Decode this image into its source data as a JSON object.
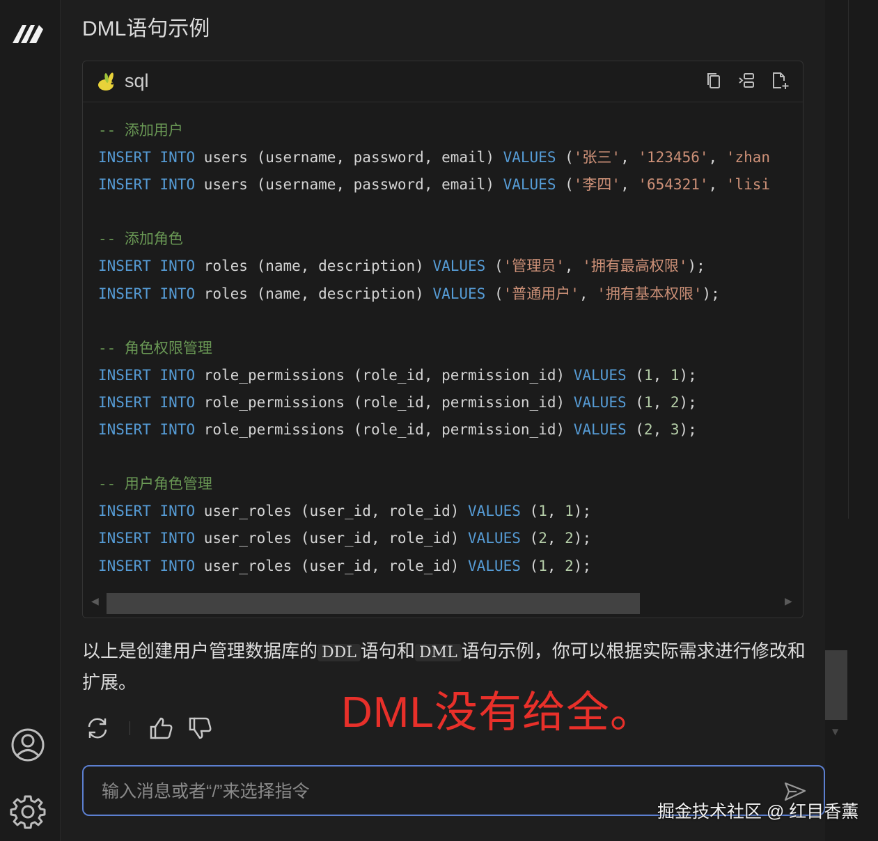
{
  "section_title": "DML语句示例",
  "code_block": {
    "language": "sql",
    "lines": [
      [
        {
          "t": "-- 添加用户",
          "c": "cm"
        }
      ],
      [
        {
          "t": "INSERT",
          "c": "kw"
        },
        {
          "t": " ",
          "c": "pl"
        },
        {
          "t": "INTO",
          "c": "kw"
        },
        {
          "t": " users (username, password, email) ",
          "c": "pl"
        },
        {
          "t": "VALUES",
          "c": "kw"
        },
        {
          "t": " (",
          "c": "pl"
        },
        {
          "t": "'张三'",
          "c": "st"
        },
        {
          "t": ", ",
          "c": "pl"
        },
        {
          "t": "'123456'",
          "c": "st"
        },
        {
          "t": ", ",
          "c": "pl"
        },
        {
          "t": "'zhan",
          "c": "st"
        }
      ],
      [
        {
          "t": "INSERT",
          "c": "kw"
        },
        {
          "t": " ",
          "c": "pl"
        },
        {
          "t": "INTO",
          "c": "kw"
        },
        {
          "t": " users (username, password, email) ",
          "c": "pl"
        },
        {
          "t": "VALUES",
          "c": "kw"
        },
        {
          "t": " (",
          "c": "pl"
        },
        {
          "t": "'李四'",
          "c": "st"
        },
        {
          "t": ", ",
          "c": "pl"
        },
        {
          "t": "'654321'",
          "c": "st"
        },
        {
          "t": ", ",
          "c": "pl"
        },
        {
          "t": "'lisi",
          "c": "st"
        }
      ],
      [],
      [
        {
          "t": "-- 添加角色",
          "c": "cm"
        }
      ],
      [
        {
          "t": "INSERT",
          "c": "kw"
        },
        {
          "t": " ",
          "c": "pl"
        },
        {
          "t": "INTO",
          "c": "kw"
        },
        {
          "t": " roles (name, description) ",
          "c": "pl"
        },
        {
          "t": "VALUES",
          "c": "kw"
        },
        {
          "t": " (",
          "c": "pl"
        },
        {
          "t": "'管理员'",
          "c": "st"
        },
        {
          "t": ", ",
          "c": "pl"
        },
        {
          "t": "'拥有最高权限'",
          "c": "st"
        },
        {
          "t": ");",
          "c": "pl"
        }
      ],
      [
        {
          "t": "INSERT",
          "c": "kw"
        },
        {
          "t": " ",
          "c": "pl"
        },
        {
          "t": "INTO",
          "c": "kw"
        },
        {
          "t": " roles (name, description) ",
          "c": "pl"
        },
        {
          "t": "VALUES",
          "c": "kw"
        },
        {
          "t": " (",
          "c": "pl"
        },
        {
          "t": "'普通用户'",
          "c": "st"
        },
        {
          "t": ", ",
          "c": "pl"
        },
        {
          "t": "'拥有基本权限'",
          "c": "st"
        },
        {
          "t": ");",
          "c": "pl"
        }
      ],
      [],
      [
        {
          "t": "-- 角色权限管理",
          "c": "cm"
        }
      ],
      [
        {
          "t": "INSERT",
          "c": "kw"
        },
        {
          "t": " ",
          "c": "pl"
        },
        {
          "t": "INTO",
          "c": "kw"
        },
        {
          "t": " role_permissions (role_id, permission_id) ",
          "c": "pl"
        },
        {
          "t": "VALUES",
          "c": "kw"
        },
        {
          "t": " (",
          "c": "pl"
        },
        {
          "t": "1",
          "c": "nm"
        },
        {
          "t": ", ",
          "c": "pl"
        },
        {
          "t": "1",
          "c": "nm"
        },
        {
          "t": ");",
          "c": "pl"
        }
      ],
      [
        {
          "t": "INSERT",
          "c": "kw"
        },
        {
          "t": " ",
          "c": "pl"
        },
        {
          "t": "INTO",
          "c": "kw"
        },
        {
          "t": " role_permissions (role_id, permission_id) ",
          "c": "pl"
        },
        {
          "t": "VALUES",
          "c": "kw"
        },
        {
          "t": " (",
          "c": "pl"
        },
        {
          "t": "1",
          "c": "nm"
        },
        {
          "t": ", ",
          "c": "pl"
        },
        {
          "t": "2",
          "c": "nm"
        },
        {
          "t": ");",
          "c": "pl"
        }
      ],
      [
        {
          "t": "INSERT",
          "c": "kw"
        },
        {
          "t": " ",
          "c": "pl"
        },
        {
          "t": "INTO",
          "c": "kw"
        },
        {
          "t": " role_permissions (role_id, permission_id) ",
          "c": "pl"
        },
        {
          "t": "VALUES",
          "c": "kw"
        },
        {
          "t": " (",
          "c": "pl"
        },
        {
          "t": "2",
          "c": "nm"
        },
        {
          "t": ", ",
          "c": "pl"
        },
        {
          "t": "3",
          "c": "nm"
        },
        {
          "t": ");",
          "c": "pl"
        }
      ],
      [],
      [
        {
          "t": "-- 用户角色管理",
          "c": "cm"
        }
      ],
      [
        {
          "t": "INSERT",
          "c": "kw"
        },
        {
          "t": " ",
          "c": "pl"
        },
        {
          "t": "INTO",
          "c": "kw"
        },
        {
          "t": " user_roles (user_id, role_id) ",
          "c": "pl"
        },
        {
          "t": "VALUES",
          "c": "kw"
        },
        {
          "t": " (",
          "c": "pl"
        },
        {
          "t": "1",
          "c": "nm"
        },
        {
          "t": ", ",
          "c": "pl"
        },
        {
          "t": "1",
          "c": "nm"
        },
        {
          "t": ");",
          "c": "pl"
        }
      ],
      [
        {
          "t": "INSERT",
          "c": "kw"
        },
        {
          "t": " ",
          "c": "pl"
        },
        {
          "t": "INTO",
          "c": "kw"
        },
        {
          "t": " user_roles (user_id, role_id) ",
          "c": "pl"
        },
        {
          "t": "VALUES",
          "c": "kw"
        },
        {
          "t": " (",
          "c": "pl"
        },
        {
          "t": "2",
          "c": "nm"
        },
        {
          "t": ", ",
          "c": "pl"
        },
        {
          "t": "2",
          "c": "nm"
        },
        {
          "t": ");",
          "c": "pl"
        }
      ],
      [
        {
          "t": "INSERT",
          "c": "kw"
        },
        {
          "t": " ",
          "c": "pl"
        },
        {
          "t": "INTO",
          "c": "kw"
        },
        {
          "t": " user_roles (user_id, role_id) ",
          "c": "pl"
        },
        {
          "t": "VALUES",
          "c": "kw"
        },
        {
          "t": " (",
          "c": "pl"
        },
        {
          "t": "1",
          "c": "nm"
        },
        {
          "t": ", ",
          "c": "pl"
        },
        {
          "t": "2",
          "c": "nm"
        },
        {
          "t": ");",
          "c": "pl"
        }
      ]
    ]
  },
  "answer": {
    "part1": "以上是创建用户管理数据库的",
    "code1": "DDL",
    "part2": "语句和",
    "code2": "DML",
    "part3": "语句示例，你可以根据实际需求进行修改和扩展。"
  },
  "annotation": "DML没有给全。",
  "input": {
    "placeholder": "输入消息或者“/”来选择指令"
  },
  "watermark": "掘金技术社区 @ 红目香薰",
  "icons": {
    "logo": "app-logo-icon",
    "copy": "copy-icon",
    "wrap": "wrap-icon",
    "insert": "insert-file-icon",
    "regenerate": "regenerate-icon",
    "like": "thumbs-up-icon",
    "dislike": "thumbs-down-icon",
    "user": "user-icon",
    "settings": "gear-icon",
    "send": "send-icon"
  },
  "colors": {
    "keyword": "#569cd6",
    "comment": "#6a9955",
    "string": "#ce9178",
    "number": "#b5cea8",
    "annotation": "#e8302a",
    "input_border": "#5c7fd0"
  }
}
